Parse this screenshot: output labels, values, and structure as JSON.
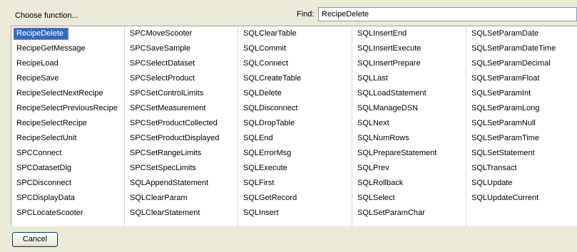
{
  "header": {
    "choose_label": "Choose function...",
    "find_label": "Find:",
    "find_value": "RecipeDelete"
  },
  "list": {
    "columns": [
      [
        "RecipeDelete",
        "RecipeGetMessage",
        "RecipeLoad",
        "RecipeSave",
        "RecipeSelectNextRecipe",
        "RecipeSelectPreviousRecipe",
        "RecipeSelectRecipe",
        "RecipeSelectUnit",
        "SPCConnect",
        "SPCDatasetDlg",
        "SPCDisconnect",
        "SPCDisplayData",
        "SPCLocateScooter"
      ],
      [
        "SPCMoveScooter",
        "SPCSaveSample",
        "SPCSelectDataset",
        "SPCSelectProduct",
        "SPCSetControlLimits",
        "SPCSetMeasurement",
        "SPCSetProductCollected",
        "SPCSetProductDisplayed",
        "SPCSetRangeLimits",
        "SPCSetSpecLimits",
        "SQLAppendStatement",
        "SQLClearParam",
        "SQLClearStatement"
      ],
      [
        "SQLClearTable",
        "SQLCommit",
        "SQLConnect",
        "SQLCreateTable",
        "SQLDelete",
        "SQLDisconnect",
        "SQLDropTable",
        "SQLEnd",
        "SQLErrorMsg",
        "SQLExecute",
        "SQLFirst",
        "SQLGetRecord",
        "SQLInsert"
      ],
      [
        "SQLInsertEnd",
        "SQLInsertExecute",
        "SQLInsertPrepare",
        "SQLLast",
        "SQLLoadStatement",
        "SQLManageDSN",
        "SQLNext",
        "SQLNumRows",
        "SQLPrepareStatement",
        "SQLPrev",
        "SQLRollback",
        "SQLSelect",
        "SQLSetParamChar"
      ],
      [
        "SQLSetParamDate",
        "SQLSetParamDateTime",
        "SQLSetParamDecimal",
        "SQLSetParamFloat",
        "SQLSetParamInt",
        "SQLSetParamLong",
        "SQLSetParamNull",
        "SQLSetParamTime",
        "SQLSetStatement",
        "SQLTransact",
        "SQLUpdate",
        "SQLUpdateCurrent"
      ]
    ],
    "selected": "RecipeDelete"
  },
  "footer": {
    "cancel_label": "Cancel"
  }
}
